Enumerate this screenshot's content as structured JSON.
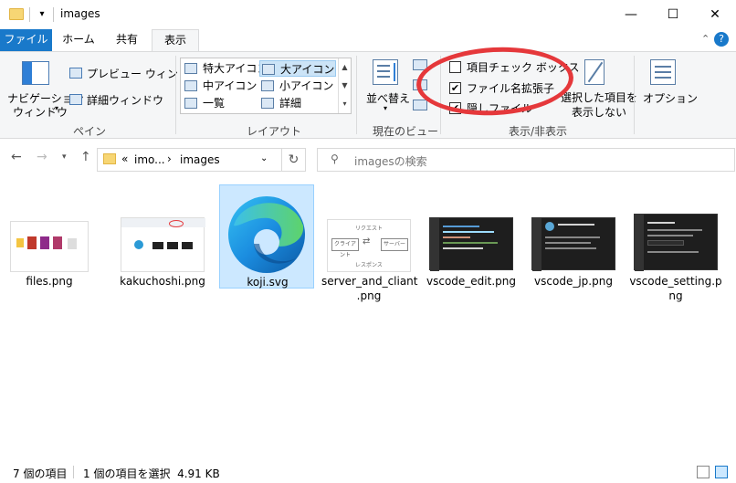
{
  "window": {
    "title": "images",
    "minimize_glyph": "—",
    "maximize_glyph": "☐",
    "close_glyph": "✕"
  },
  "tabs": [
    {
      "label": "ファイル"
    },
    {
      "label": "ホーム"
    },
    {
      "label": "共有"
    },
    {
      "label": "表示"
    }
  ],
  "ribbon": {
    "pane": {
      "nav_pane_label": "ナビゲーション",
      "nav_pane_label2": "ウィンドウ",
      "preview_label": "プレビュー ウィンドウ",
      "details_label": "詳細ウィンドウ",
      "group_label": "ペイン"
    },
    "layout": {
      "items": [
        {
          "label": "特大アイコン"
        },
        {
          "label": "大アイコン"
        },
        {
          "label": "中アイコン"
        },
        {
          "label": "小アイコン"
        },
        {
          "label": "一覧"
        },
        {
          "label": "詳細"
        }
      ],
      "group_label": "レイアウト"
    },
    "current_view": {
      "sort_label": "並べ替え",
      "group_label": "現在のビュー"
    },
    "show_hide": {
      "item_checkboxes": "項目チェック ボックス",
      "file_extensions": "ファイル名拡張子",
      "hidden_items": "隠しファイル",
      "hide_selected": "選択した項目を",
      "hide_selected2": "表示しない",
      "group_label": "表示/非表示"
    },
    "options_label": "オプション"
  },
  "nav": {
    "breadcrumb_prefix": "«",
    "breadcrumb_parent": "imo...",
    "breadcrumb_sep": "›",
    "breadcrumb_current": "images",
    "search_placeholder": "imagesの検索"
  },
  "files": [
    {
      "name": "files.png"
    },
    {
      "name": "kakuchoshi.png"
    },
    {
      "name": "koji.svg"
    },
    {
      "name": "server_and_cliant",
      "name2": ".png"
    },
    {
      "name": "vscode_edit.png"
    },
    {
      "name": "vscode_jp.png"
    },
    {
      "name": "vscode_setting.p",
      "name2": "ng"
    }
  ],
  "thumb_text": {
    "request": "リクエスト",
    "client": "クライアント",
    "server": "サーバー",
    "response": "レスポンス"
  },
  "status": {
    "item_count": "7 個の項目",
    "selection": "1 個の項目を選択  4.91 KB"
  },
  "colors": {
    "accent": "#1979ca",
    "selection_bg": "#cce8ff",
    "annotation_circle": "#e5383b"
  }
}
